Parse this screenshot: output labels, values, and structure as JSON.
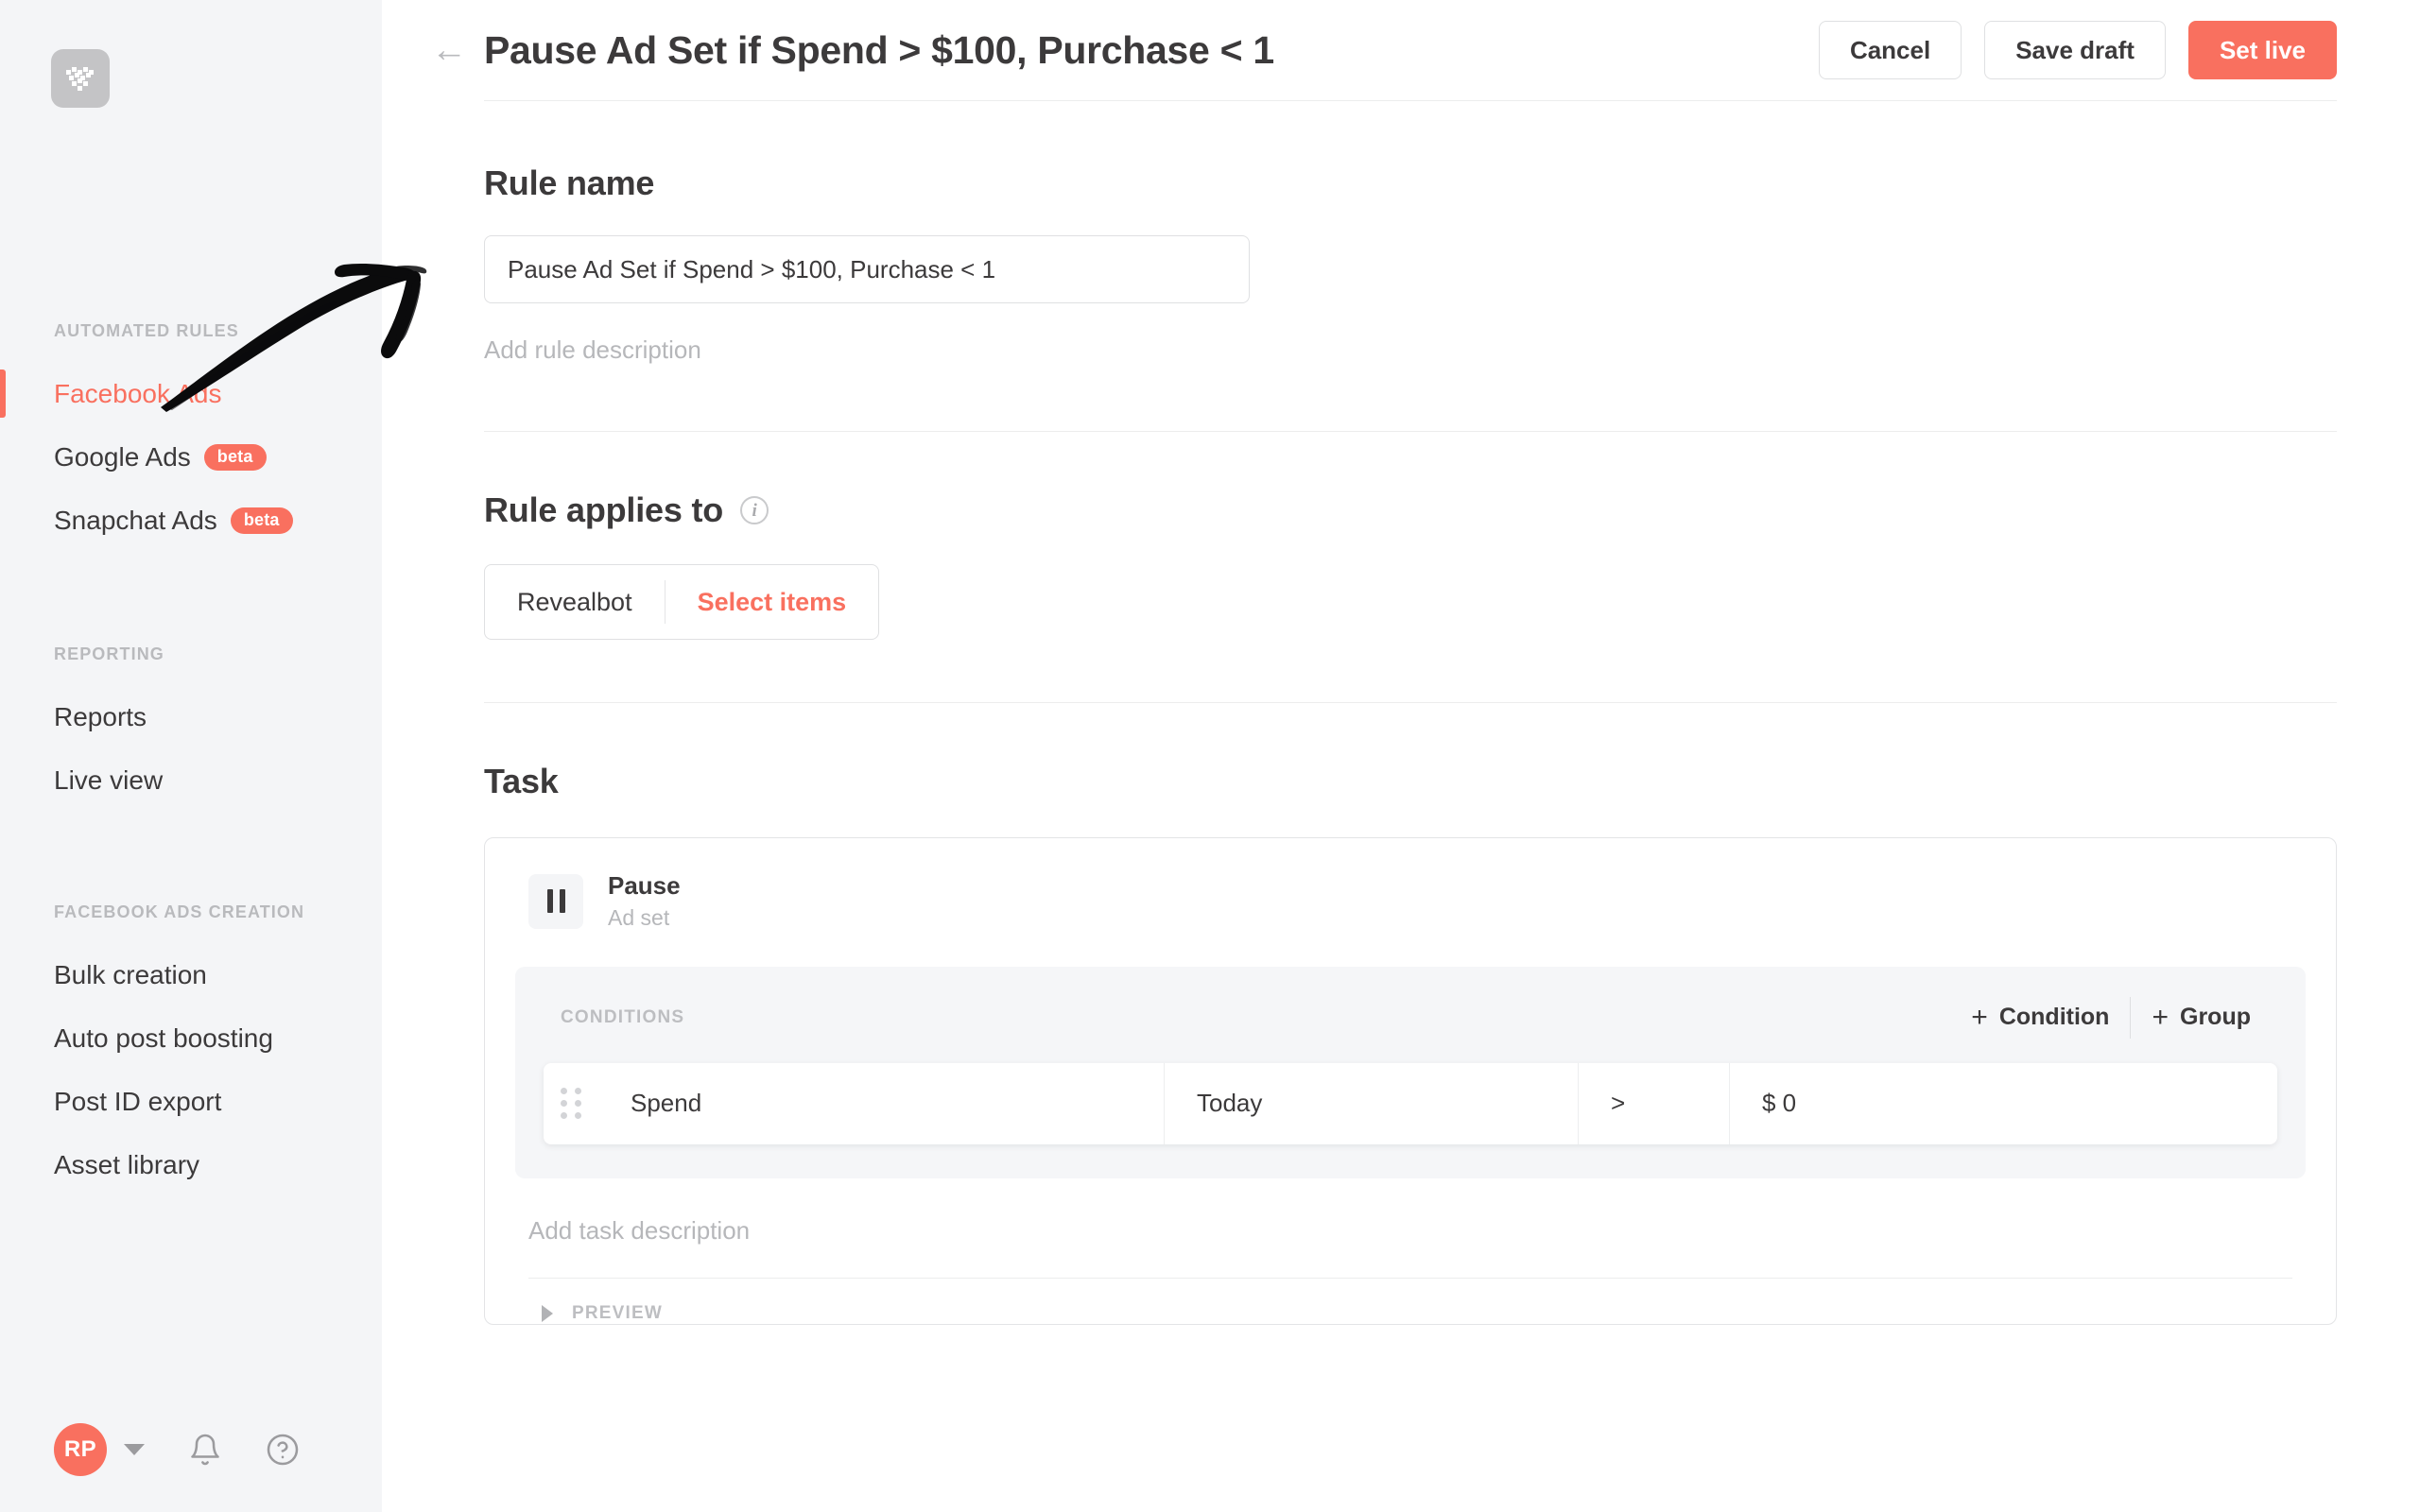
{
  "brand": {
    "accent": "#f9705f",
    "logo_icon": "revealbot-logo-icon",
    "sidebar_bg": "#f4f5f7"
  },
  "sidebar": {
    "groups": [
      {
        "label": "AUTOMATED RULES",
        "items": [
          {
            "label": "Facebook Ads",
            "active": true,
            "badge": ""
          },
          {
            "label": "Google Ads",
            "active": false,
            "badge": "beta"
          },
          {
            "label": "Snapchat Ads",
            "active": false,
            "badge": "beta"
          }
        ]
      },
      {
        "label": "REPORTING",
        "items": [
          {
            "label": "Reports",
            "active": false,
            "badge": ""
          },
          {
            "label": "Live view",
            "active": false,
            "badge": ""
          }
        ]
      },
      {
        "label": "FACEBOOK ADS CREATION",
        "items": [
          {
            "label": "Bulk creation",
            "active": false,
            "badge": ""
          },
          {
            "label": "Auto post boosting",
            "active": false,
            "badge": ""
          },
          {
            "label": "Post ID export",
            "active": false,
            "badge": ""
          },
          {
            "label": "Asset library",
            "active": false,
            "badge": ""
          }
        ]
      }
    ],
    "footer": {
      "avatar_initials": "RP",
      "caret_icon": "chevron-down-icon",
      "notifications_icon": "bell-icon",
      "help_icon": "help-circle-icon"
    }
  },
  "topbar": {
    "back_icon": "arrow-left-icon",
    "title": "Pause Ad Set if Spend > $100, Purchase < 1",
    "cancel_label": "Cancel",
    "save_draft_label": "Save draft",
    "set_live_label": "Set live"
  },
  "rule_name": {
    "heading": "Rule name",
    "value": "Pause Ad Set if Spend > $100, Purchase < 1",
    "placeholder": "Rule name",
    "description_link": "Add rule description"
  },
  "rule_applies_to": {
    "heading": "Rule applies to",
    "info_icon": "info-icon",
    "segments": [
      {
        "label": "Revealbot",
        "accent": false
      },
      {
        "label": "Select items",
        "accent": true
      }
    ]
  },
  "task": {
    "heading": "Task",
    "action_icon": "pause-icon",
    "action_name": "Pause",
    "action_level": "Ad set",
    "conditions": {
      "label": "CONDITIONS",
      "add_condition_label": "Condition",
      "add_group_label": "Group",
      "plus_glyph": "+",
      "columns": [
        "metric",
        "time_window",
        "operator",
        "value"
      ],
      "rows": [
        {
          "drag_icon": "drag-handle-icon",
          "metric": "Spend",
          "time_window": "Today",
          "operator": ">",
          "value": "$ 0"
        }
      ]
    },
    "description_link": "Add task description",
    "preview_label": "PREVIEW",
    "preview_caret_icon": "caret-right-icon"
  },
  "annotation": {
    "type": "hand-drawn-brush-arrow",
    "points_at": "Facebook Ads"
  }
}
